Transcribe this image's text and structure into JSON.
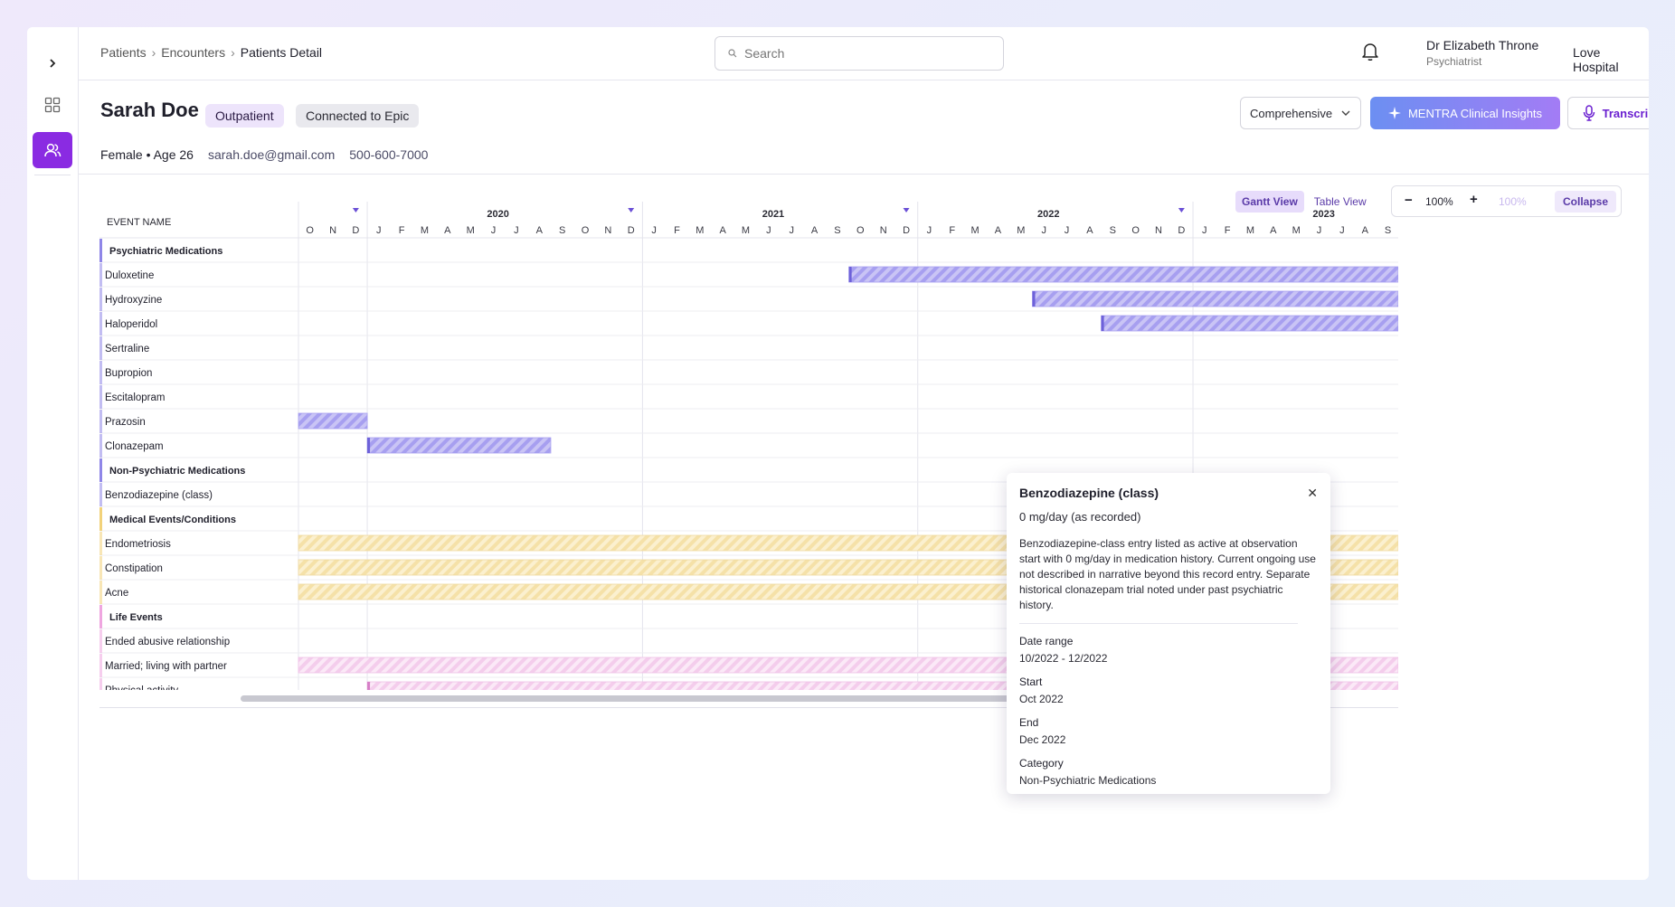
{
  "breadcrumb": {
    "items": [
      "Patients",
      "Encounters"
    ],
    "current": "Patients Detail",
    "sep": "›"
  },
  "search": {
    "placeholder": "Search"
  },
  "user": {
    "name": "Dr Elizabeth Throne",
    "role": "Psychiatrist"
  },
  "hospital": "Love Hospital",
  "patient": {
    "name": "Sarah Doe",
    "type_badge": "Outpatient",
    "epic_badge": "Connected to Epic",
    "demographics": "Female • Age 26",
    "email": "sarah.doe@gmail.com",
    "phone": "500-600-7000"
  },
  "toolbar": {
    "view_select": "Comprehensive",
    "insights_label": "MENTRA Clinical Insights",
    "transcribe_label": "Transcribe"
  },
  "views": {
    "gantt": "Gantt View",
    "table": "Table View"
  },
  "zoom": {
    "minus": "−",
    "value": "100%",
    "plus": "+",
    "reset": "100%",
    "collapse": "Collapse"
  },
  "colors": {
    "accent": "#8a2be2",
    "psych": "#8f86e8",
    "medical": "#f2d27a",
    "life": "#efa6e0"
  },
  "gantt": {
    "event_header": "EVENT NAME",
    "year_labels": [
      "2020",
      "2021",
      "2022",
      "2023"
    ],
    "month_labels": [
      "O",
      "N",
      "D",
      "J",
      "F",
      "M",
      "A",
      "M",
      "J",
      "J",
      "A",
      "S",
      "O",
      "N",
      "D",
      "J",
      "F",
      "M",
      "A",
      "M",
      "J",
      "J",
      "A",
      "S",
      "O",
      "N",
      "D",
      "J",
      "F",
      "M",
      "A",
      "M",
      "J",
      "J",
      "A",
      "S",
      "O",
      "N",
      "D",
      "J",
      "F",
      "M",
      "A",
      "M",
      "J",
      "J",
      "A",
      "S"
    ],
    "start_month": "2019-10",
    "rows": [
      {
        "label": "Psychiatric Medications",
        "kind": "section",
        "cat": "psych"
      },
      {
        "label": "Duloxetine",
        "kind": "item",
        "cat": "psych",
        "start": "2021-10",
        "end": "ongoing"
      },
      {
        "label": "Hydroxyzine",
        "kind": "item",
        "cat": "psych",
        "start": "2022-06",
        "end": "ongoing"
      },
      {
        "label": "Haloperidol",
        "kind": "item",
        "cat": "psych",
        "start": "2022-09",
        "end": "ongoing"
      },
      {
        "label": "Sertraline",
        "kind": "item",
        "cat": "psych"
      },
      {
        "label": "Bupropion",
        "kind": "item",
        "cat": "psych"
      },
      {
        "label": "Escitalopram",
        "kind": "item",
        "cat": "psych"
      },
      {
        "label": "Prazosin",
        "kind": "item",
        "cat": "psych",
        "start": "2019-10",
        "end": "2019-12"
      },
      {
        "label": "Clonazepam",
        "kind": "item",
        "cat": "psych",
        "start": "2020-01",
        "end": "2020-08"
      },
      {
        "label": "Non-Psychiatric Medications",
        "kind": "section",
        "cat": "psych"
      },
      {
        "label": "Benzodiazepine (class)",
        "kind": "item",
        "cat": "psych",
        "start": "2022-10",
        "end": "2022-12",
        "selected": true
      },
      {
        "label": "Medical Events/Conditions",
        "kind": "section",
        "cat": "medical"
      },
      {
        "label": "Endometriosis",
        "kind": "item",
        "cat": "medical",
        "start": "2019-10",
        "end": "ongoing"
      },
      {
        "label": "Constipation",
        "kind": "item",
        "cat": "medical",
        "start": "2019-10",
        "end": "ongoing"
      },
      {
        "label": "Acne",
        "kind": "item",
        "cat": "medical",
        "start": "2019-10",
        "end": "ongoing"
      },
      {
        "label": "Life Events",
        "kind": "section",
        "cat": "life"
      },
      {
        "label": "Ended abusive relationship",
        "kind": "item",
        "cat": "life"
      },
      {
        "label": "Married; living with partner",
        "kind": "item",
        "cat": "life",
        "start": "2019-10",
        "end": "ongoing"
      },
      {
        "label": "Physical activity",
        "kind": "item",
        "cat": "life",
        "start": "2020-01",
        "end": "ongoing"
      }
    ]
  },
  "tooltip": {
    "title": "Benzodiazepine (class)",
    "dose": "0 mg/day (as recorded)",
    "description": "Benzodiazepine-class entry listed as active at observation start with 0 mg/day in medication history. Current ongoing use not described in narrative beyond this record entry. Separate historical clonazepam trial noted under past psychiatric history.",
    "date_range_label": "Date range",
    "date_range": "10/2022 - 12/2022",
    "start_label": "Start",
    "start": "Oct 2022",
    "end_label": "End",
    "end": "Dec 2022",
    "category_label": "Category",
    "category": "Non-Psychiatric Medications"
  }
}
